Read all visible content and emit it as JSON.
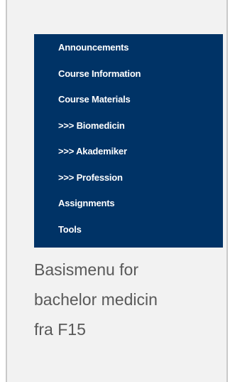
{
  "menu": {
    "items": [
      {
        "label": "Announcements"
      },
      {
        "label": "Course Information"
      },
      {
        "label": "Course Materials"
      },
      {
        "label": ">>> Biomedicin"
      },
      {
        "label": ">>> Akademiker"
      },
      {
        "label": ">>> Profession"
      },
      {
        "label": "Assignments"
      },
      {
        "label": "Tools"
      }
    ],
    "background_color": "#003366",
    "text_color": "#ffffff"
  },
  "caption": {
    "line1": "Basismenu for",
    "line2": "bachelor medicin",
    "line3": "fra F15"
  }
}
